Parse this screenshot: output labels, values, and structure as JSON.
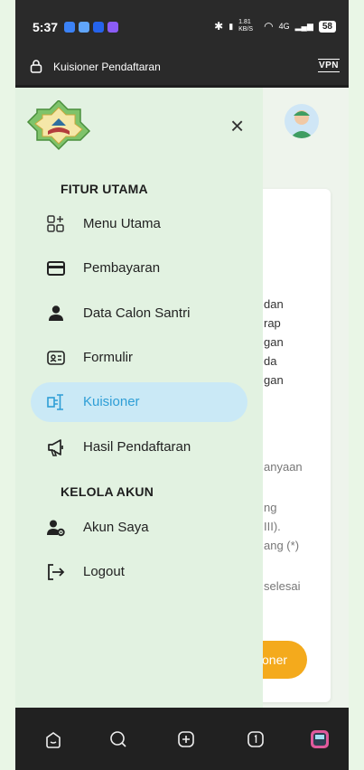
{
  "status_bar": {
    "time": "5:37",
    "speed": "1.81 KB/S",
    "network": "4G",
    "battery": "58"
  },
  "browser": {
    "url": "Kuisioner Pendaftaran",
    "vpn_label": "VPN"
  },
  "drawer": {
    "close_label": "×",
    "sections": {
      "main": "FITUR UTAMA",
      "account": "KELOLA AKUN"
    },
    "items": [
      {
        "label": "Menu Utama",
        "icon": "grid-plus-icon"
      },
      {
        "label": "Pembayaran",
        "icon": "credit-card-icon"
      },
      {
        "label": "Data Calon Santri",
        "icon": "person-icon"
      },
      {
        "label": "Formulir",
        "icon": "id-card-icon"
      },
      {
        "label": "Kuisioner",
        "icon": "questionnaire-icon",
        "active": true
      },
      {
        "label": "Hasil Pendaftaran",
        "icon": "megaphone-icon"
      },
      {
        "label": "Akun Saya",
        "icon": "user-settings-icon"
      },
      {
        "label": "Logout",
        "icon": "logout-icon"
      }
    ]
  },
  "background_text": {
    "lines1": [
      "dan",
      "rap",
      "gan",
      "da",
      "gan"
    ],
    "line2": "anyaan",
    "lines3": [
      "ng",
      "III).",
      "ang (*)"
    ],
    "line4": "selesai",
    "button": "oner"
  },
  "colors": {
    "accent": "#2e9ed6",
    "active_bg": "#cae9f6",
    "drawer_bg": "#e2f2e1",
    "button": "#f4aa1c"
  }
}
